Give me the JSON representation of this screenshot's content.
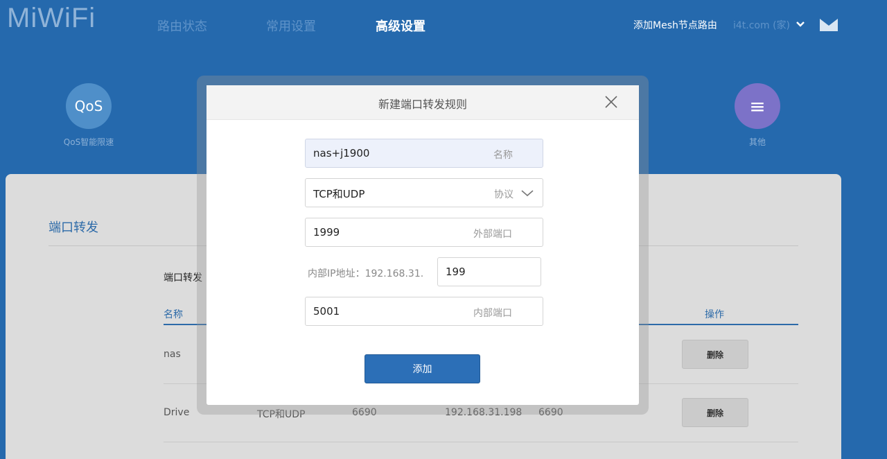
{
  "header": {
    "logo": "MiWiFi",
    "nav": [
      "路由状态",
      "常用设置",
      "高级设置"
    ],
    "active_nav": "高级设置",
    "add_mesh": "添加Mesh节点路由",
    "user": "i4t.com (家)",
    "icons": {
      "account_dropdown": "chevron-down-icon",
      "mail": "mail-icon"
    }
  },
  "apps": [
    {
      "label": "QoS智能限速",
      "icon_text": "QoS",
      "color": "#4f8fc9"
    },
    {
      "label": "其他",
      "icon_text": "≡",
      "color": "#7c72c8"
    }
  ],
  "page": {
    "title": "端口转发",
    "subtitle": "端口转发",
    "columns": {
      "name": "名称",
      "action": "操作"
    },
    "rows": [
      {
        "name": "nas",
        "protocol": "",
        "ext_port": "",
        "ip": "",
        "int_port": "",
        "action": "删除"
      },
      {
        "name": "Drive",
        "protocol": "TCP和UDP",
        "ext_port": "6690",
        "ip": "192.168.31.198",
        "int_port": "6690",
        "action": "删除"
      }
    ]
  },
  "modal": {
    "title": "新建端口转发规则",
    "name_value": "nas+j1900",
    "name_placeholder": "名称",
    "protocol_value": "TCP和UDP",
    "protocol_placeholder": "协议",
    "ext_port_value": "1999",
    "ext_port_placeholder": "外部端口",
    "ip_prefix": "内部IP地址：192.168.31.",
    "ip_suffix": "199",
    "int_port_value": "5001",
    "int_port_placeholder": "内部端口",
    "submit_label": "添加"
  }
}
